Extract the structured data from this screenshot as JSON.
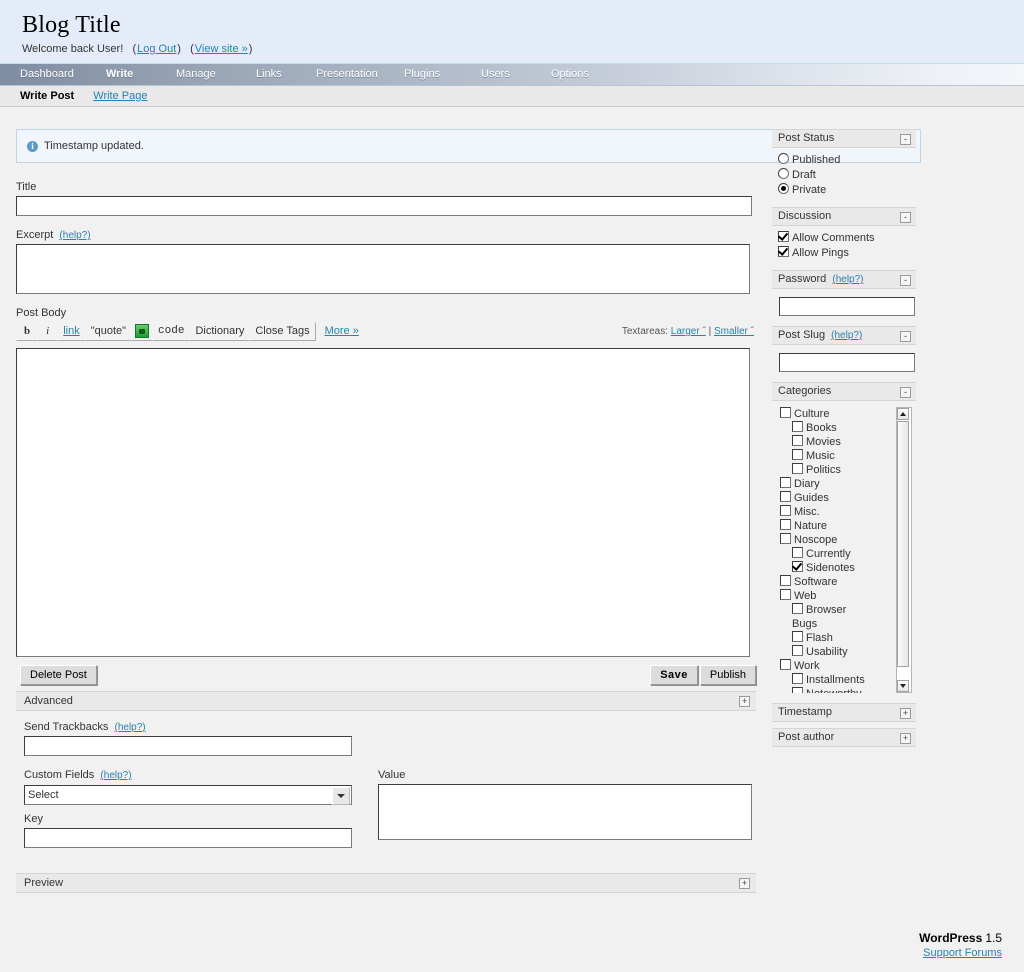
{
  "header": {
    "blog_title": "Blog Title",
    "welcome": "Welcome back User!",
    "logout_open": "(",
    "logout": "Log Out",
    "logout_close": ")",
    "viewsite_open": "(",
    "viewsite": "View site »",
    "viewsite_close": ")"
  },
  "nav": {
    "items": [
      {
        "label": "Dashboard",
        "current": false
      },
      {
        "label": "Write",
        "current": true
      },
      {
        "label": "Manage",
        "current": false
      },
      {
        "label": "Links",
        "current": false
      },
      {
        "label": "Presentation",
        "current": false
      },
      {
        "label": "Plugins",
        "current": false
      },
      {
        "label": "Users",
        "current": false
      },
      {
        "label": "Options",
        "current": false
      }
    ]
  },
  "subnav": {
    "current": "Write Post",
    "other": "Write Page"
  },
  "notice": {
    "icon": "info-icon",
    "text": "Timestamp updated."
  },
  "form": {
    "title_label": "Title",
    "title_value": "",
    "excerpt_label": "Excerpt",
    "excerpt_help": "(help?)",
    "excerpt_value": "",
    "postbody_label": "Post Body",
    "postbody_value": ""
  },
  "toolbar": {
    "buttons": [
      {
        "label": "b",
        "name": "bold-button"
      },
      {
        "label": "i",
        "name": "italic-button"
      },
      {
        "label": "link",
        "name": "link-button"
      },
      {
        "label": "\"quote\"",
        "name": "quote-button"
      },
      {
        "label": "",
        "name": "image-button"
      },
      {
        "label": "code",
        "name": "code-button"
      },
      {
        "label": "Dictionary",
        "name": "dictionary-button"
      },
      {
        "label": "Close Tags",
        "name": "close-tags-button"
      }
    ],
    "more": "More »",
    "textareas_label": "Textareas:",
    "larger": "Larger ˆ",
    "divider": "|",
    "smaller": "Smaller ˆ"
  },
  "actions": {
    "delete": "Delete Post",
    "save": "Save",
    "publish": "Publish"
  },
  "advanced": {
    "header": "Advanced",
    "toggle": "+",
    "trackbacks_label": "Send Trackbacks",
    "trackbacks_help": "(help?)",
    "trackbacks_value": "",
    "customfields_label": "Custom Fields",
    "customfields_help": "(help?)",
    "select_value": "Select",
    "key_label": "Key",
    "key_value": "",
    "value_label": "Value",
    "value_value": ""
  },
  "preview": {
    "header": "Preview",
    "toggle": "+"
  },
  "sidebar": {
    "post_status": {
      "header": "Post Status",
      "toggle": "-",
      "options": [
        {
          "label": "Published",
          "selected": false
        },
        {
          "label": "Draft",
          "selected": false
        },
        {
          "label": "Private",
          "selected": true
        }
      ]
    },
    "discussion": {
      "header": "Discussion",
      "toggle": "-",
      "options": [
        {
          "label": "Allow Comments",
          "checked": true
        },
        {
          "label": "Allow Pings",
          "checked": true
        }
      ]
    },
    "password": {
      "header": "Password",
      "help": "(help?)",
      "toggle": "-",
      "value": ""
    },
    "post_slug": {
      "header": "Post Slug",
      "help": "(help?)",
      "toggle": "-",
      "value": ""
    },
    "categories": {
      "header": "Categories",
      "toggle": "-",
      "items": [
        {
          "label": "Culture",
          "depth": 1,
          "checkbox": true,
          "checked": false
        },
        {
          "label": "Books",
          "depth": 2,
          "checkbox": true,
          "checked": false
        },
        {
          "label": "Movies",
          "depth": 2,
          "checkbox": true,
          "checked": false
        },
        {
          "label": "Music",
          "depth": 2,
          "checkbox": true,
          "checked": false
        },
        {
          "label": "Politics",
          "depth": 2,
          "checkbox": true,
          "checked": false
        },
        {
          "label": "Diary",
          "depth": 1,
          "checkbox": true,
          "checked": false
        },
        {
          "label": "Guides",
          "depth": 1,
          "checkbox": true,
          "checked": false
        },
        {
          "label": "Misc.",
          "depth": 1,
          "checkbox": true,
          "checked": false
        },
        {
          "label": "Nature",
          "depth": 1,
          "checkbox": true,
          "checked": false
        },
        {
          "label": "Noscope",
          "depth": 1,
          "checkbox": true,
          "checked": false
        },
        {
          "label": "Currently",
          "depth": 2,
          "checkbox": true,
          "checked": false
        },
        {
          "label": "Sidenotes",
          "depth": 2,
          "checkbox": true,
          "checked": true
        },
        {
          "label": "Software",
          "depth": 1,
          "checkbox": true,
          "checked": false
        },
        {
          "label": "Web",
          "depth": 1,
          "checkbox": true,
          "checked": false
        },
        {
          "label": "Browser",
          "depth": 2,
          "checkbox": true,
          "checked": false
        },
        {
          "label": "Bugs",
          "depth": 2,
          "checkbox": false,
          "checked": false
        },
        {
          "label": "Flash",
          "depth": 2,
          "checkbox": true,
          "checked": false
        },
        {
          "label": "Usability",
          "depth": 2,
          "checkbox": true,
          "checked": false
        },
        {
          "label": "Work",
          "depth": 1,
          "checkbox": true,
          "checked": false
        },
        {
          "label": "Installments",
          "depth": 2,
          "checkbox": true,
          "checked": false
        },
        {
          "label": "Noteworthy",
          "depth": 2,
          "checkbox": true,
          "checked": false
        }
      ]
    },
    "timestamp": {
      "header": "Timestamp",
      "toggle": "+"
    },
    "post_author": {
      "header": "Post author",
      "toggle": "+"
    }
  },
  "footer": {
    "app": "WordPress",
    "version": "1.5",
    "support": "Support Forums"
  }
}
